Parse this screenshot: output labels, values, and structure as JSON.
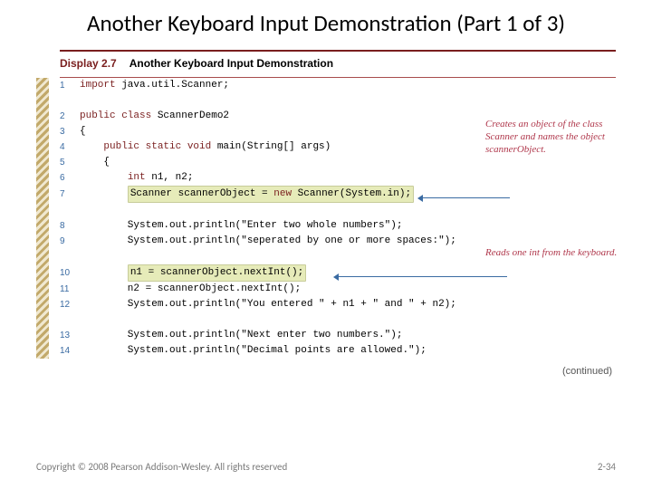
{
  "title": "Another Keyboard Input Demonstration (Part 1 of 3)",
  "display": {
    "label": "Display 2.7",
    "title": "Another Keyboard Input Demonstration"
  },
  "annotations": {
    "a1": "Creates an object of the class Scanner and names the object scannerObject.",
    "a2": "Reads one int from the keyboard."
  },
  "code": {
    "l1": {
      "n": "1",
      "kw": "import",
      "rest": " java.util.Scanner;"
    },
    "l2": {
      "n": "2",
      "kw": "public class",
      "rest": " ScannerDemo2"
    },
    "l3": {
      "n": "3",
      "txt": "{"
    },
    "l4": {
      "n": "4",
      "pre": "    ",
      "kw": "public static void",
      "rest": " main(String[] args)"
    },
    "l5": {
      "n": "5",
      "txt": "    {"
    },
    "l6": {
      "n": "6",
      "pre": "        ",
      "kw": "int",
      "rest": " n1, n2;"
    },
    "l7": {
      "n": "7",
      "pre": "        ",
      "hl_pre": "Scanner scannerObject = ",
      "hl_kw": "new",
      "hl_post": " Scanner(System.in);"
    },
    "l8": {
      "n": "8",
      "txt": "        System.out.println(\"Enter two whole numbers\");"
    },
    "l9": {
      "n": "9",
      "txt": "        System.out.println(\"seperated by one or more spaces:\");"
    },
    "l10": {
      "n": "10",
      "pre": "        ",
      "hl": "n1 = scannerObject.nextInt();"
    },
    "l11": {
      "n": "11",
      "txt": "        n2 = scannerObject.nextInt();"
    },
    "l12": {
      "n": "12",
      "txt": "        System.out.println(\"You entered \" + n1 + \" and \" + n2);"
    },
    "l13": {
      "n": "13",
      "txt": "        System.out.println(\"Next enter two numbers.\");"
    },
    "l14": {
      "n": "14",
      "txt": "        System.out.println(\"Decimal points are allowed.\");"
    }
  },
  "continued": "(continued)",
  "footer": {
    "copyright": "Copyright © 2008 Pearson Addison-Wesley. All rights reserved",
    "page": "2-34"
  }
}
